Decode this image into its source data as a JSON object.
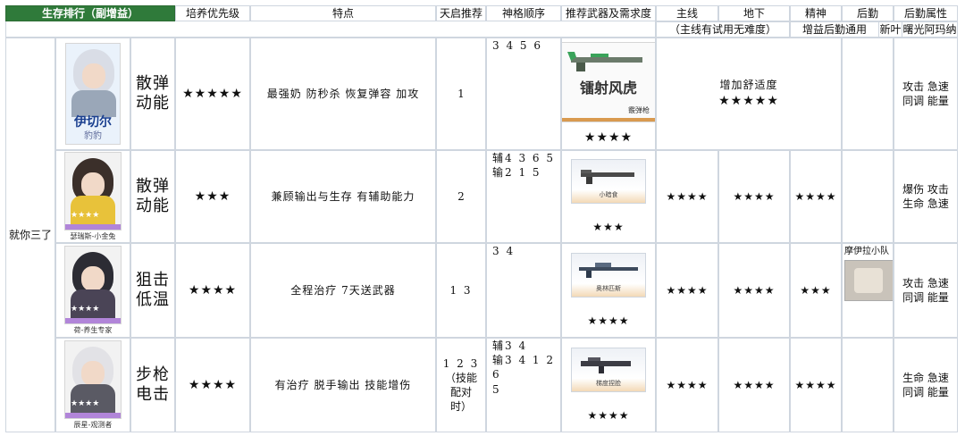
{
  "headers": {
    "ranking": "生存排行（副增益）",
    "priority": "培养优先级",
    "traits": "特点",
    "tianqi": "天启推荐",
    "shenge": "神格顺序",
    "weapon": "推荐武器及需求度",
    "mainline": "主线",
    "underground": "地下",
    "spirit": "精神",
    "logistics": "后勤",
    "logistics_attr": "后勤属性",
    "mainline_note": "（主线有试用无难度）",
    "spirit_note": "增益后勤通用",
    "logistics_note": "新叶",
    "attr_note": "曙光阿玛纳"
  },
  "group_label": "就你三了",
  "rows": [
    {
      "portrait_big": "伊切尔",
      "portrait_small": "豹豹",
      "role_line1": "散弹",
      "role_line2": "动能",
      "priority": "★★★★★",
      "traits": "最强奶 防秒杀 恢复弹容 加攻",
      "tianqi": "1",
      "shenge": [
        "3 4 5 6"
      ],
      "weapon_name": "镭射风虎",
      "weapon_sub": "霰弹枪",
      "weapon_stars": "★★★★",
      "merged_note": "增加舒适度",
      "merged_stars": "★★★★★",
      "attr": [
        "攻击 急速",
        "同调 能量"
      ]
    },
    {
      "caption": "瑟瑞斯-小金兔",
      "role_line1": "散弹",
      "role_line2": "动能",
      "priority": "★★★",
      "traits": "兼顾输出与生存 有辅助能力",
      "tianqi": "2",
      "shenge": [
        "辅4 3 6 5",
        "输2 1 5"
      ],
      "weapon_label": "小暗食",
      "weapon_stars": "★★★",
      "mainline": "★★★★",
      "underground": "★★★★",
      "spirit": "★★★★",
      "attr": [
        "爆伤 攻击",
        "生命 急速"
      ]
    },
    {
      "caption": "荷-养生专家",
      "role_line1": "狙击",
      "role_line2": "低温",
      "priority": "★★★★",
      "traits": "全程治疗 7天送武器",
      "tianqi": "1 3",
      "shenge": [
        "3 4"
      ],
      "weapon_label": "奥林匹斯",
      "weapon_stars": "★★★★",
      "mainline": "★★★★",
      "underground": "★★★★",
      "spirit": "★★★",
      "logistics_name": "摩伊拉小队",
      "attr": [
        "攻击 急速",
        "同调 能量"
      ]
    },
    {
      "caption": "辰星-观测者",
      "role_line1": "步枪",
      "role_line2": "电击",
      "priority": "★★★★",
      "traits": "有治疗 脱手输出 技能增伤",
      "tianqi": [
        "1 2 3",
        "（技能",
        "配对",
        "时）"
      ],
      "shenge": [
        "辅3 4",
        "输3 4 1 2 6",
        "5"
      ],
      "weapon_label": "梯度捏脸",
      "weapon_stars": "★★★★",
      "mainline": "★★★★",
      "underground": "★★★★",
      "spirit": "★★★★",
      "attr": [
        "生命 急速",
        "同调 能量"
      ]
    }
  ],
  "colors": {
    "header_green": "#2f7a3a",
    "grid_line": "#cfd6df",
    "portrait_accent": "#b185d9"
  }
}
